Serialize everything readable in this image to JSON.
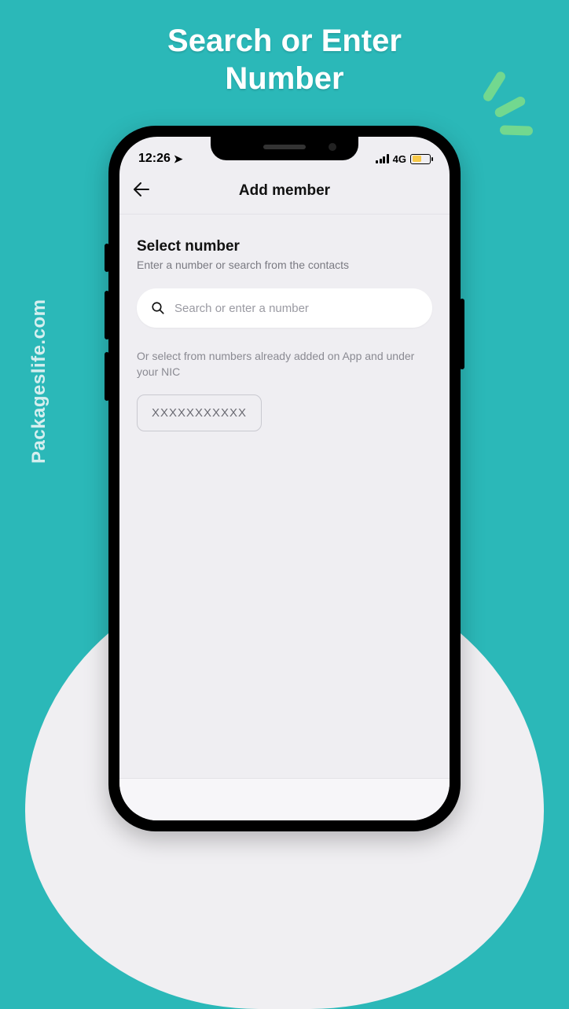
{
  "page": {
    "title_line1": "Search or Enter",
    "title_line2": "Number",
    "watermark": "Packageslife.com"
  },
  "status": {
    "time": "12:26",
    "network_label": "4G"
  },
  "header": {
    "title": "Add member"
  },
  "section": {
    "title": "Select number",
    "subtitle": "Enter a number or search from the contacts"
  },
  "search": {
    "placeholder": "Search or enter a number"
  },
  "or_text": "Or select from numbers already added on App and under your NIC",
  "numbers": [
    {
      "masked": "XXXXXXXXXXX"
    }
  ]
}
